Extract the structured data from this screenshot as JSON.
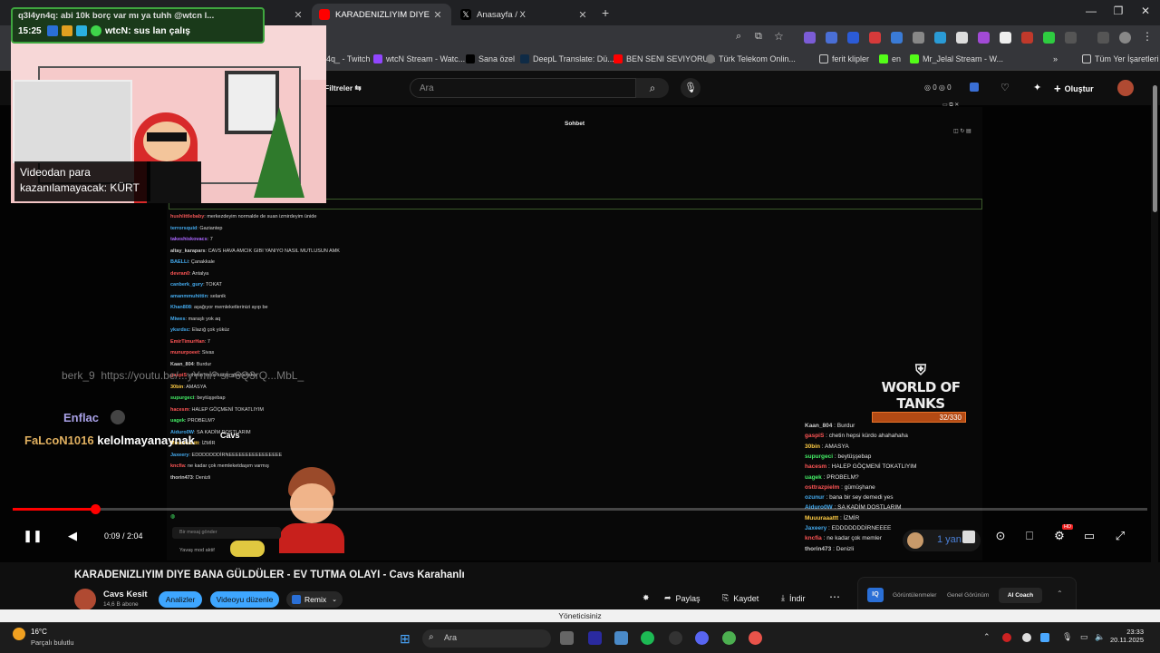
{
  "tabs": [
    {
      "label": "",
      "active": false
    },
    {
      "label": "KARADENIZLIYIM DIYE BANA GÜLDÜLER",
      "active": true
    },
    {
      "label": "Anasayfa / X",
      "active": false
    }
  ],
  "notification": {
    "title": "q3l4yn4q: abi 10k borç var mı ya tuhh @wtcn l...",
    "time": "15:25",
    "message": "wtcN: sus lan çalış"
  },
  "bookmarks": [
    "4q_ - Twitch",
    "wtcN Stream - Watc...",
    "Sana özel",
    "DeepL Translate: Dü...",
    "BEN SENI SEVIYORU...",
    "Türk Telekom Onlin...",
    "ferit klipler",
    "en",
    "Mr_Jelal Stream - W...",
    "Tüm Yer İşaretleri"
  ],
  "youtube_header": {
    "filters": "Filtreler",
    "search_placeholder": "Ara",
    "counts": [
      "0",
      "0"
    ],
    "create_label": "Oluştur"
  },
  "overlay": {
    "monetization": "Videodan para kazanılamayacak: KÜRT",
    "chat_header": "Sohbet",
    "viewers": "32/330",
    "wot_logo": "WORLD OF TANKS",
    "streamer_tag": "Cavs",
    "left_names": [
      {
        "name": "berk_9",
        "text": "https://youtu.be/...yYml? si=6Q3rQ...MbL_"
      },
      {
        "name": "Enflac",
        "text": ""
      },
      {
        "name": "FaLcoN1016",
        "text": "kelolmayanaynak"
      }
    ],
    "chat_lines": [
      {
        "user": "hushlittlebaby",
        "msg": "merkezdeyim normalde de suan izmirdeyim ünide",
        "color": "#e55"
      },
      {
        "user": "terrorsquid",
        "msg": "Gaziantep",
        "color": "#4ae"
      },
      {
        "user": "takeshiskovacs",
        "msg": "7",
        "color": "#a6f"
      },
      {
        "user": "altay_karapars",
        "msg": "CAVS HAVA AMCIK GIBI YANIYO NASIL MUTLUSUN AMK",
        "color": "#ccc"
      },
      {
        "user": "BAELLi",
        "msg": "Çanakkale",
        "color": "#4ae"
      },
      {
        "user": "devran0",
        "msg": "Antalya",
        "color": "#f55"
      },
      {
        "user": "canberk_gury",
        "msg": "TOKAT",
        "color": "#4ae"
      },
      {
        "user": "amanmmuhittin",
        "msg": "selanik",
        "color": "#4ae"
      },
      {
        "user": "Khan808",
        "msg": "aşağıyor memleketlerinizi ayıp be",
        "color": "#4ae"
      },
      {
        "user": "Miwes",
        "msg": "maraşlı yok aq",
        "color": "#4ae"
      },
      {
        "user": "yksrdsc",
        "msg": "Elazığ çok yüküz",
        "color": "#4ae"
      },
      {
        "user": "EmirTimurHan",
        "msg": "7",
        "color": "#f55"
      },
      {
        "user": "munurpoeet",
        "msg": "Sivas",
        "color": "#f55"
      },
      {
        "user": "Kaan_804",
        "msg": "Burdur",
        "color": "#ccc"
      },
      {
        "user": "gaspiS",
        "msg": "chetin hepsi kürdo ahahahaha",
        "color": "#f55"
      },
      {
        "user": "30bin",
        "msg": "AMASYA",
        "color": "#fc4"
      },
      {
        "user": "supurgeci",
        "msg": "beytüşşebap",
        "color": "#4e6"
      },
      {
        "user": "hacesm",
        "msg": "HALEP GÖÇMENİ TOKATLIYIM",
        "color": "#f55"
      },
      {
        "user": "uagek",
        "msg": "PROBELM?",
        "color": "#4e6"
      },
      {
        "user": "Aiduro0W",
        "msg": "SA KADİM DOSTLARIM",
        "color": "#4ae"
      },
      {
        "user": "Muuuraaattt",
        "msg": "İZMİR",
        "color": "#fc4"
      },
      {
        "user": "Jaxeery",
        "msg": "EDDDDDDDİRNEEEEEEEEEEEEEEEE",
        "color": "#4ae"
      },
      {
        "user": "kncfia",
        "msg": "ne kadar çok memleketdaşım varmış",
        "color": "#f55"
      },
      {
        "user": "thorin473",
        "msg": "Denizli",
        "color": "#ccc"
      }
    ],
    "right_chat": [
      {
        "user": "Kaan_804",
        "msg": "Burdur",
        "color": "#ccc"
      },
      {
        "user": "gaspiS",
        "msg": "chetin hepsi kürdo ahahahaha",
        "color": "#f55"
      },
      {
        "user": "30bin",
        "msg": "AMASYA",
        "color": "#fc4"
      },
      {
        "user": "supurgeci",
        "msg": "beytüşşebap",
        "color": "#4e6"
      },
      {
        "user": "hacesm",
        "msg": "HALEP GÖÇMENİ TOKATLIYIM",
        "color": "#f55"
      },
      {
        "user": "uagek",
        "msg": "PROBELM?",
        "color": "#4e6"
      },
      {
        "user": "osttrazpielm",
        "msg": "gümüşhane",
        "color": "#f55"
      },
      {
        "user": "ozunur",
        "msg": "bana bir sey demedi yes",
        "color": "#4ae"
      },
      {
        "user": "Aiduro0W",
        "msg": "SA KADİM DOSTLARIM",
        "color": "#4ae"
      },
      {
        "user": "Muuuraaattt",
        "msg": "İZMİR",
        "color": "#fc4"
      },
      {
        "user": "Jaxeery",
        "msg": "EDDDDDDDİRNEEEE",
        "color": "#4ae"
      },
      {
        "user": "kncfia",
        "msg": "ne kadar çok memler",
        "color": "#f55"
      },
      {
        "user": "thorin473",
        "msg": "Denizli",
        "color": "#ccc"
      }
    ],
    "chat_input_placeholder": "Bir mesaj gönder",
    "slow_mode": "Yavaş mod aktif",
    "reply_count": "1 yanıt"
  },
  "player": {
    "time": "0:09 / 2:04",
    "progress_fraction": 0.073
  },
  "video": {
    "title": "KARADENIZLIYIM DIYE BANA GÜLDÜLER - EV TUTMA OLAYI - Cavs Karahanlı",
    "channel": "Cavs Kesit",
    "subscribers": "14,6 B abone",
    "btn_analyze": "Analizler",
    "btn_edit": "Videoyu düzenle",
    "btn_remix": "Remix",
    "btn_share": "Paylaş",
    "btn_save": "Kaydet",
    "btn_download": "İndir",
    "panel_views": "Görüntülenmeler",
    "panel_overview": "Genel Görünüm",
    "panel_ai": "AI Coach"
  },
  "manager_banner": "Yöneticisiniz",
  "taskbar": {
    "temp": "16°C",
    "weather": "Parçalı bulutlu",
    "search": "Ara",
    "clock_time": "23:33",
    "clock_date": "20.11.2025"
  },
  "colors": {
    "accent": "#ff0000",
    "pill_blue": "#3ea6ff",
    "yt_bg": "#0f0f0f"
  }
}
